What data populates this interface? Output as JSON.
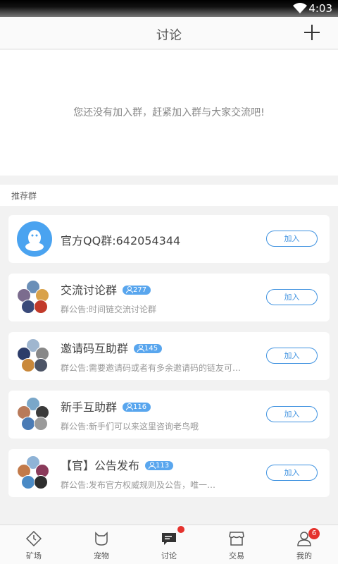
{
  "status": {
    "time": "4:03"
  },
  "nav": {
    "title": "讨论"
  },
  "empty_message": "您还没有加入群，赶紧加入群与大家交流吧!",
  "section_label": "推荐群",
  "join_label": "加入",
  "groups": [
    {
      "name": "官方QQ群:642054344"
    },
    {
      "name": "交流讨论群",
      "members": "277",
      "notice": "群公告:时间链交流讨论群"
    },
    {
      "name": "邀请码互助群",
      "members": "145",
      "notice": "群公告:需要邀请码或者有多余邀请码的链友可…"
    },
    {
      "name": "新手互助群",
      "members": "116",
      "notice": "群公告:新手们可以来这里咨询老鸟哦"
    },
    {
      "name": "【官】公告发布",
      "members": "113",
      "notice": "群公告:发布官方权威规则及公告，唯一…"
    }
  ],
  "tabs": [
    {
      "label": "矿场",
      "icon": "clock-diamond-icon"
    },
    {
      "label": "宠物",
      "icon": "cat-icon"
    },
    {
      "label": "讨论",
      "icon": "chat-icon",
      "dot": true
    },
    {
      "label": "交易",
      "icon": "shop-icon"
    },
    {
      "label": "我的",
      "icon": "person-icon",
      "badge": "6"
    }
  ],
  "colors": {
    "accent": "#3f92e0",
    "badge": "#e5322d",
    "qq": "#4aa3f0"
  }
}
